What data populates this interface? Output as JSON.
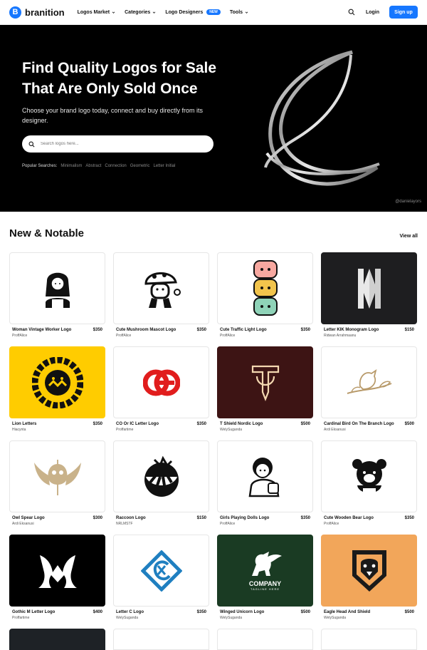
{
  "nav": {
    "logo_letter": "B",
    "logo_text": "branition",
    "menu": [
      {
        "label": "Logos Market"
      },
      {
        "label": "Categories"
      },
      {
        "label": "Logo Designers",
        "badge": "NEW"
      },
      {
        "label": "Tools"
      }
    ],
    "login": "Login",
    "signup": "Sign up"
  },
  "hero": {
    "title": "Find Quality Logos for Sale That Are Only Sold Once",
    "subtitle": "Choose your brand logo today, connect and buy directly from its designer.",
    "search_placeholder": "Search logos here...",
    "popular_label": "Popular Searches:",
    "popular_tags": [
      "Minimalism",
      "Abstract",
      "Connection",
      "Geometric",
      "Letter Initial"
    ],
    "credit": "@danielayors"
  },
  "section": {
    "title": "New & Notable",
    "view_all": "View all"
  },
  "colors": {
    "accent": "#1677ff",
    "hero_bg": "#000000"
  },
  "products": [
    {
      "name": "Woman Vintage Worker Logo",
      "price": "$350",
      "author": "ProffAlice",
      "bg": "#ffffff",
      "icon": "woman-worker-icon"
    },
    {
      "name": "Cute Mushroom Mascot Logo",
      "price": "$350",
      "author": "ProffAlice",
      "bg": "#ffffff",
      "icon": "mushroom-mascot-icon"
    },
    {
      "name": "Cute Traffic Light Logo",
      "price": "$350",
      "author": "ProffAlice",
      "bg": "#ffffff",
      "icon": "traffic-light-icon"
    },
    {
      "name": "Letter KIK Monogram Logo",
      "price": "$150",
      "author": "Ridwan Arrahmaanu",
      "bg": "#1e1e20",
      "icon": "kik-monogram-icon"
    },
    {
      "name": "Lion Letters",
      "price": "$350",
      "author": "Hiacynta",
      "bg": "#ffcc00",
      "icon": "lion-letters-icon"
    },
    {
      "name": "CO Or IC Letter Logo",
      "price": "$350",
      "author": "Proffartime",
      "bg": "#ffffff",
      "icon": "co-letter-icon"
    },
    {
      "name": "T Shield Nordic Logo",
      "price": "$500",
      "author": "WelySuganda",
      "bg": "#3d1414",
      "icon": "t-shield-icon"
    },
    {
      "name": "Cardinal Bird On The Branch Logo",
      "price": "$500",
      "author": "Ardi Eksanusi",
      "bg": "#ffffff",
      "icon": "cardinal-bird-icon"
    },
    {
      "name": "Owl Spear Logo",
      "price": "$300",
      "author": "Ardi Eksanusi",
      "bg": "#ffffff",
      "icon": "owl-spear-icon"
    },
    {
      "name": "Raccoon Logo",
      "price": "$150",
      "author": "NRLMSTF",
      "bg": "#ffffff",
      "icon": "raccoon-icon"
    },
    {
      "name": "Girls Playing Dolls Logo",
      "price": "$350",
      "author": "ProffAlice",
      "bg": "#ffffff",
      "icon": "girl-dolls-icon"
    },
    {
      "name": "Cute Wooden Bear Logo",
      "price": "$350",
      "author": "ProffAlice",
      "bg": "#ffffff",
      "icon": "wooden-bear-icon"
    },
    {
      "name": "Gothic M Letter Logo",
      "price": "$400",
      "author": "Proffartime",
      "bg": "#000000",
      "icon": "gothic-m-icon"
    },
    {
      "name": "Letter C Logo",
      "price": "$350",
      "author": "WelySuganda",
      "bg": "#ffffff",
      "icon": "letter-c-icon"
    },
    {
      "name": "Winged Unicorn Logo",
      "price": "$500",
      "author": "WelySuganda",
      "bg": "#1a3b23",
      "icon": "winged-unicorn-icon",
      "brand_text": "COMPANY",
      "brand_tagline": "TAGLINE HERE"
    },
    {
      "name": "Eagle Head And Shield",
      "price": "$500",
      "author": "WelySuganda",
      "bg": "#f2a65a",
      "icon": "eagle-shield-icon"
    }
  ],
  "row5": [
    {
      "bg": "#1e2226"
    },
    {
      "bg": "#ffffff"
    },
    {
      "bg": "#ffffff"
    },
    {
      "bg": "#ffffff"
    }
  ]
}
